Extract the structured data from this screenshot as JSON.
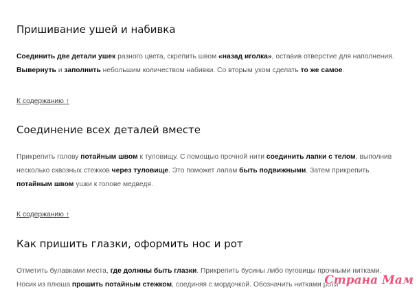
{
  "sections": [
    {
      "heading": "Пришивание ушей и набивка",
      "paragraph": [
        [
          {
            "b": true,
            "t": "Соединить две детали ушек"
          },
          {
            "t": " разного цвета, скрепить швом "
          },
          {
            "b": true,
            "t": "«назад иголка»"
          },
          {
            "t": ", оставив отверстие для наполнения."
          }
        ],
        [
          {
            "b": true,
            "t": "Вывернуть"
          },
          {
            "t": " и "
          },
          {
            "b": true,
            "t": "заполнить"
          },
          {
            "t": " небольшим количеством набивки. Со вторым ухом сделать "
          },
          {
            "b": true,
            "t": "то же самое"
          },
          {
            "t": "."
          }
        ]
      ],
      "toc_link": "К содержанию ↑"
    },
    {
      "heading": "Соединение всех деталей вместе",
      "paragraph": [
        [
          {
            "t": "Прикрепить голову "
          },
          {
            "b": true,
            "t": "потайным швом"
          },
          {
            "t": " к туловищу. С помощью прочной нити "
          },
          {
            "b": true,
            "t": "соединить лапки с телом"
          },
          {
            "t": ", выполнив"
          }
        ],
        [
          {
            "t": "несколько сквозных стежков "
          },
          {
            "b": true,
            "t": "через туловище"
          },
          {
            "t": ". Это поможет лапам "
          },
          {
            "b": true,
            "t": "быть подвижными"
          },
          {
            "t": ". Затем прикрепить"
          }
        ],
        [
          {
            "b": true,
            "t": "потайным швом"
          },
          {
            "t": " ушки к голове медведя."
          }
        ]
      ],
      "toc_link": "К содержанию ↑"
    },
    {
      "heading": "Как пришить глазки, оформить нос и рот",
      "paragraph": [
        [
          {
            "t": "Отметить булавками места, "
          },
          {
            "b": true,
            "t": "где должны быть глазки"
          },
          {
            "t": ". Прикрепить бусины либо пуговицы прочными нитками."
          }
        ],
        [
          {
            "t": "Носик из плюша "
          },
          {
            "b": true,
            "t": "прошить потайным стежком"
          },
          {
            "t": ", соединяя с мордочкой. Обозначить нитками роти"
          }
        ]
      ]
    }
  ],
  "watermark": "Страна Мам"
}
